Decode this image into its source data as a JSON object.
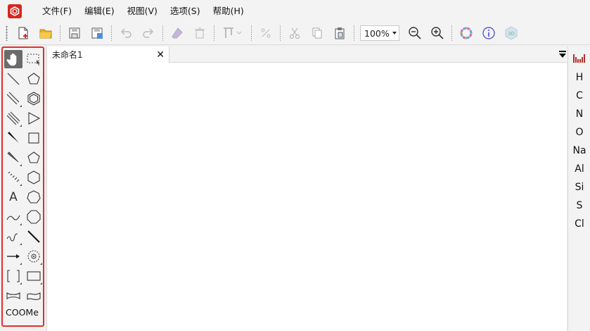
{
  "menubar": {
    "items": [
      "文件(F)",
      "编辑(E)",
      "视图(V)",
      "选项(S)",
      "帮助(H)"
    ]
  },
  "toolbar": {
    "zoom": "100%",
    "buttons": [
      "new-doc-icon",
      "open-folder-icon",
      "save-icon",
      "save-as-icon",
      "undo-icon",
      "redo-icon",
      "eraser-icon",
      "trash-icon",
      "align-icon",
      "flip-icon",
      "cut-icon",
      "copy-icon",
      "paste-icon",
      "zoom-out-icon",
      "zoom-in-icon",
      "color-wheel-icon",
      "info-icon",
      "3d-icon"
    ]
  },
  "document": {
    "tab_label": "未命名1",
    "close_symbol": "✕"
  },
  "palette": {
    "text_tool": "A",
    "group_label": "COOMe"
  },
  "elements": {
    "items": [
      "H",
      "C",
      "N",
      "O",
      "Na",
      "Al",
      "Si",
      "S",
      "Cl"
    ]
  },
  "colors": {
    "brand_red": "#d9251c",
    "palette_border": "#e0312b",
    "active_tool": "#6b6b6b"
  }
}
